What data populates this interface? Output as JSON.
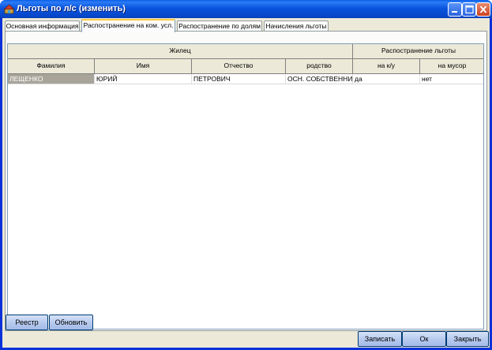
{
  "window": {
    "title": "Льготы по л/с (изменить)"
  },
  "tabs": [
    {
      "label": "Основная информация"
    },
    {
      "label": "Распостранение на ком. усл."
    },
    {
      "label": "Распостранение по долям"
    },
    {
      "label": "Начисления льготы"
    }
  ],
  "active_tab": 1,
  "grid": {
    "group_headers": {
      "resident": "Жилец",
      "spread": "Распостранение льготы"
    },
    "columns": [
      "Фамилия",
      "Имя",
      "Отчество",
      "родство",
      "на к/у",
      "на мусор"
    ],
    "rows": [
      {
        "surname": "ЛЕЩЕНКО",
        "name": "ЮРИЙ",
        "patronymic": "ПЕТРОВИЧ",
        "relation": "ОСН. СОБСТВЕННИК",
        "on_ku": "да",
        "on_garbage": "нет"
      }
    ]
  },
  "buttons": {
    "registry": "Реестр",
    "refresh": "Обновить",
    "save": "Записать",
    "ok": "Ок",
    "close": "Закрыть"
  },
  "colors": {
    "titlebar": "#0a55de",
    "selected_cell": "#a8a49a",
    "window_face": "#ece9d8"
  }
}
